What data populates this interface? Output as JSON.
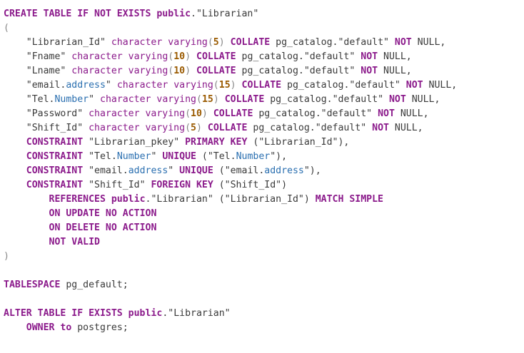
{
  "editor": {
    "lines": [
      [
        {
          "t": "CREATE TABLE IF NOT EXISTS public",
          "c": "kw"
        },
        {
          "t": ".\"Librarian\"",
          "c": "str"
        }
      ],
      [
        {
          "t": "(",
          "c": "punct"
        }
      ],
      [
        {
          "t": "    \"Librarian_Id\" ",
          "c": "str"
        },
        {
          "t": "character varying",
          "c": "fn"
        },
        {
          "t": "(",
          "c": "punct"
        },
        {
          "t": "5",
          "c": "num"
        },
        {
          "t": ") ",
          "c": "punct"
        },
        {
          "t": "COLLATE",
          "c": "kw"
        },
        {
          "t": " pg_catalog.\"default\" ",
          "c": "str"
        },
        {
          "t": "NOT",
          "c": "kw"
        },
        {
          "t": " NULL,",
          "c": "str"
        }
      ],
      [
        {
          "t": "    \"Fname\" ",
          "c": "str"
        },
        {
          "t": "character varying",
          "c": "fn"
        },
        {
          "t": "(",
          "c": "punct"
        },
        {
          "t": "10",
          "c": "num"
        },
        {
          "t": ") ",
          "c": "punct"
        },
        {
          "t": "COLLATE",
          "c": "kw"
        },
        {
          "t": " pg_catalog.\"default\" ",
          "c": "str"
        },
        {
          "t": "NOT",
          "c": "kw"
        },
        {
          "t": " NULL,",
          "c": "str"
        }
      ],
      [
        {
          "t": "    \"Lname\" ",
          "c": "str"
        },
        {
          "t": "character varying",
          "c": "fn"
        },
        {
          "t": "(",
          "c": "punct"
        },
        {
          "t": "10",
          "c": "num"
        },
        {
          "t": ") ",
          "c": "punct"
        },
        {
          "t": "COLLATE",
          "c": "kw"
        },
        {
          "t": " pg_catalog.\"default\" ",
          "c": "str"
        },
        {
          "t": "NOT",
          "c": "kw"
        },
        {
          "t": " NULL,",
          "c": "str"
        }
      ],
      [
        {
          "t": "    \"email.",
          "c": "str"
        },
        {
          "t": "address",
          "c": "prop"
        },
        {
          "t": "\" ",
          "c": "str"
        },
        {
          "t": "character varying",
          "c": "fn"
        },
        {
          "t": "(",
          "c": "punct"
        },
        {
          "t": "15",
          "c": "num"
        },
        {
          "t": ") ",
          "c": "punct"
        },
        {
          "t": "COLLATE",
          "c": "kw"
        },
        {
          "t": " pg_catalog.\"default\" ",
          "c": "str"
        },
        {
          "t": "NOT",
          "c": "kw"
        },
        {
          "t": " NULL,",
          "c": "str"
        }
      ],
      [
        {
          "t": "    \"Tel.",
          "c": "str"
        },
        {
          "t": "Number",
          "c": "prop"
        },
        {
          "t": "\" ",
          "c": "str"
        },
        {
          "t": "character varying",
          "c": "fn"
        },
        {
          "t": "(",
          "c": "punct"
        },
        {
          "t": "15",
          "c": "num"
        },
        {
          "t": ") ",
          "c": "punct"
        },
        {
          "t": "COLLATE",
          "c": "kw"
        },
        {
          "t": " pg_catalog.\"default\" ",
          "c": "str"
        },
        {
          "t": "NOT",
          "c": "kw"
        },
        {
          "t": " NULL,",
          "c": "str"
        }
      ],
      [
        {
          "t": "    \"Password\" ",
          "c": "str"
        },
        {
          "t": "character varying",
          "c": "fn"
        },
        {
          "t": "(",
          "c": "punct"
        },
        {
          "t": "10",
          "c": "num"
        },
        {
          "t": ") ",
          "c": "punct"
        },
        {
          "t": "COLLATE",
          "c": "kw"
        },
        {
          "t": " pg_catalog.\"default\" ",
          "c": "str"
        },
        {
          "t": "NOT",
          "c": "kw"
        },
        {
          "t": " NULL,",
          "c": "str"
        }
      ],
      [
        {
          "t": "    \"Shift_Id\" ",
          "c": "str"
        },
        {
          "t": "character varying",
          "c": "fn"
        },
        {
          "t": "(",
          "c": "punct"
        },
        {
          "t": "5",
          "c": "num"
        },
        {
          "t": ") ",
          "c": "punct"
        },
        {
          "t": "COLLATE",
          "c": "kw"
        },
        {
          "t": " pg_catalog.\"default\" ",
          "c": "str"
        },
        {
          "t": "NOT",
          "c": "kw"
        },
        {
          "t": " NULL,",
          "c": "str"
        }
      ],
      [
        {
          "t": "    ",
          "c": "str"
        },
        {
          "t": "CONSTRAINT",
          "c": "kw"
        },
        {
          "t": " \"Librarian_pkey\" ",
          "c": "str"
        },
        {
          "t": "PRIMARY KEY",
          "c": "kw"
        },
        {
          "t": " (\"Librarian_Id\"),",
          "c": "str"
        }
      ],
      [
        {
          "t": "    ",
          "c": "str"
        },
        {
          "t": "CONSTRAINT",
          "c": "kw"
        },
        {
          "t": " \"Tel.",
          "c": "str"
        },
        {
          "t": "Number",
          "c": "prop"
        },
        {
          "t": "\" ",
          "c": "str"
        },
        {
          "t": "UNIQUE",
          "c": "kw"
        },
        {
          "t": " (\"Tel.",
          "c": "str"
        },
        {
          "t": "Number",
          "c": "prop"
        },
        {
          "t": "\"),",
          "c": "str"
        }
      ],
      [
        {
          "t": "    ",
          "c": "str"
        },
        {
          "t": "CONSTRAINT",
          "c": "kw"
        },
        {
          "t": " \"email.",
          "c": "str"
        },
        {
          "t": "address",
          "c": "prop"
        },
        {
          "t": "\" ",
          "c": "str"
        },
        {
          "t": "UNIQUE",
          "c": "kw"
        },
        {
          "t": " (\"email.",
          "c": "str"
        },
        {
          "t": "address",
          "c": "prop"
        },
        {
          "t": "\"),",
          "c": "str"
        }
      ],
      [
        {
          "t": "    ",
          "c": "str"
        },
        {
          "t": "CONSTRAINT",
          "c": "kw"
        },
        {
          "t": " \"Shift_Id\" ",
          "c": "str"
        },
        {
          "t": "FOREIGN KEY",
          "c": "kw"
        },
        {
          "t": " (\"Shift_Id\")",
          "c": "str"
        }
      ],
      [
        {
          "t": "        ",
          "c": "str"
        },
        {
          "t": "REFERENCES public",
          "c": "kw"
        },
        {
          "t": ".\"Librarian\" (\"Librarian_Id\") ",
          "c": "str"
        },
        {
          "t": "MATCH SIMPLE",
          "c": "kw"
        }
      ],
      [
        {
          "t": "        ",
          "c": "str"
        },
        {
          "t": "ON UPDATE NO ACTION",
          "c": "kw"
        }
      ],
      [
        {
          "t": "        ",
          "c": "str"
        },
        {
          "t": "ON DELETE NO ACTION",
          "c": "kw"
        }
      ],
      [
        {
          "t": "        ",
          "c": "str"
        },
        {
          "t": "NOT VALID",
          "c": "kw"
        }
      ],
      [
        {
          "t": ")",
          "c": "punct"
        }
      ],
      [],
      [
        {
          "t": "TABLESPACE",
          "c": "kw"
        },
        {
          "t": " pg_default;",
          "c": "str"
        }
      ],
      [],
      [
        {
          "t": "ALTER TABLE IF EXISTS public",
          "c": "kw"
        },
        {
          "t": ".\"Librarian\"",
          "c": "str"
        }
      ],
      [
        {
          "t": "    ",
          "c": "str"
        },
        {
          "t": "OWNER to",
          "c": "kw"
        },
        {
          "t": " postgres;",
          "c": "str"
        }
      ]
    ]
  }
}
